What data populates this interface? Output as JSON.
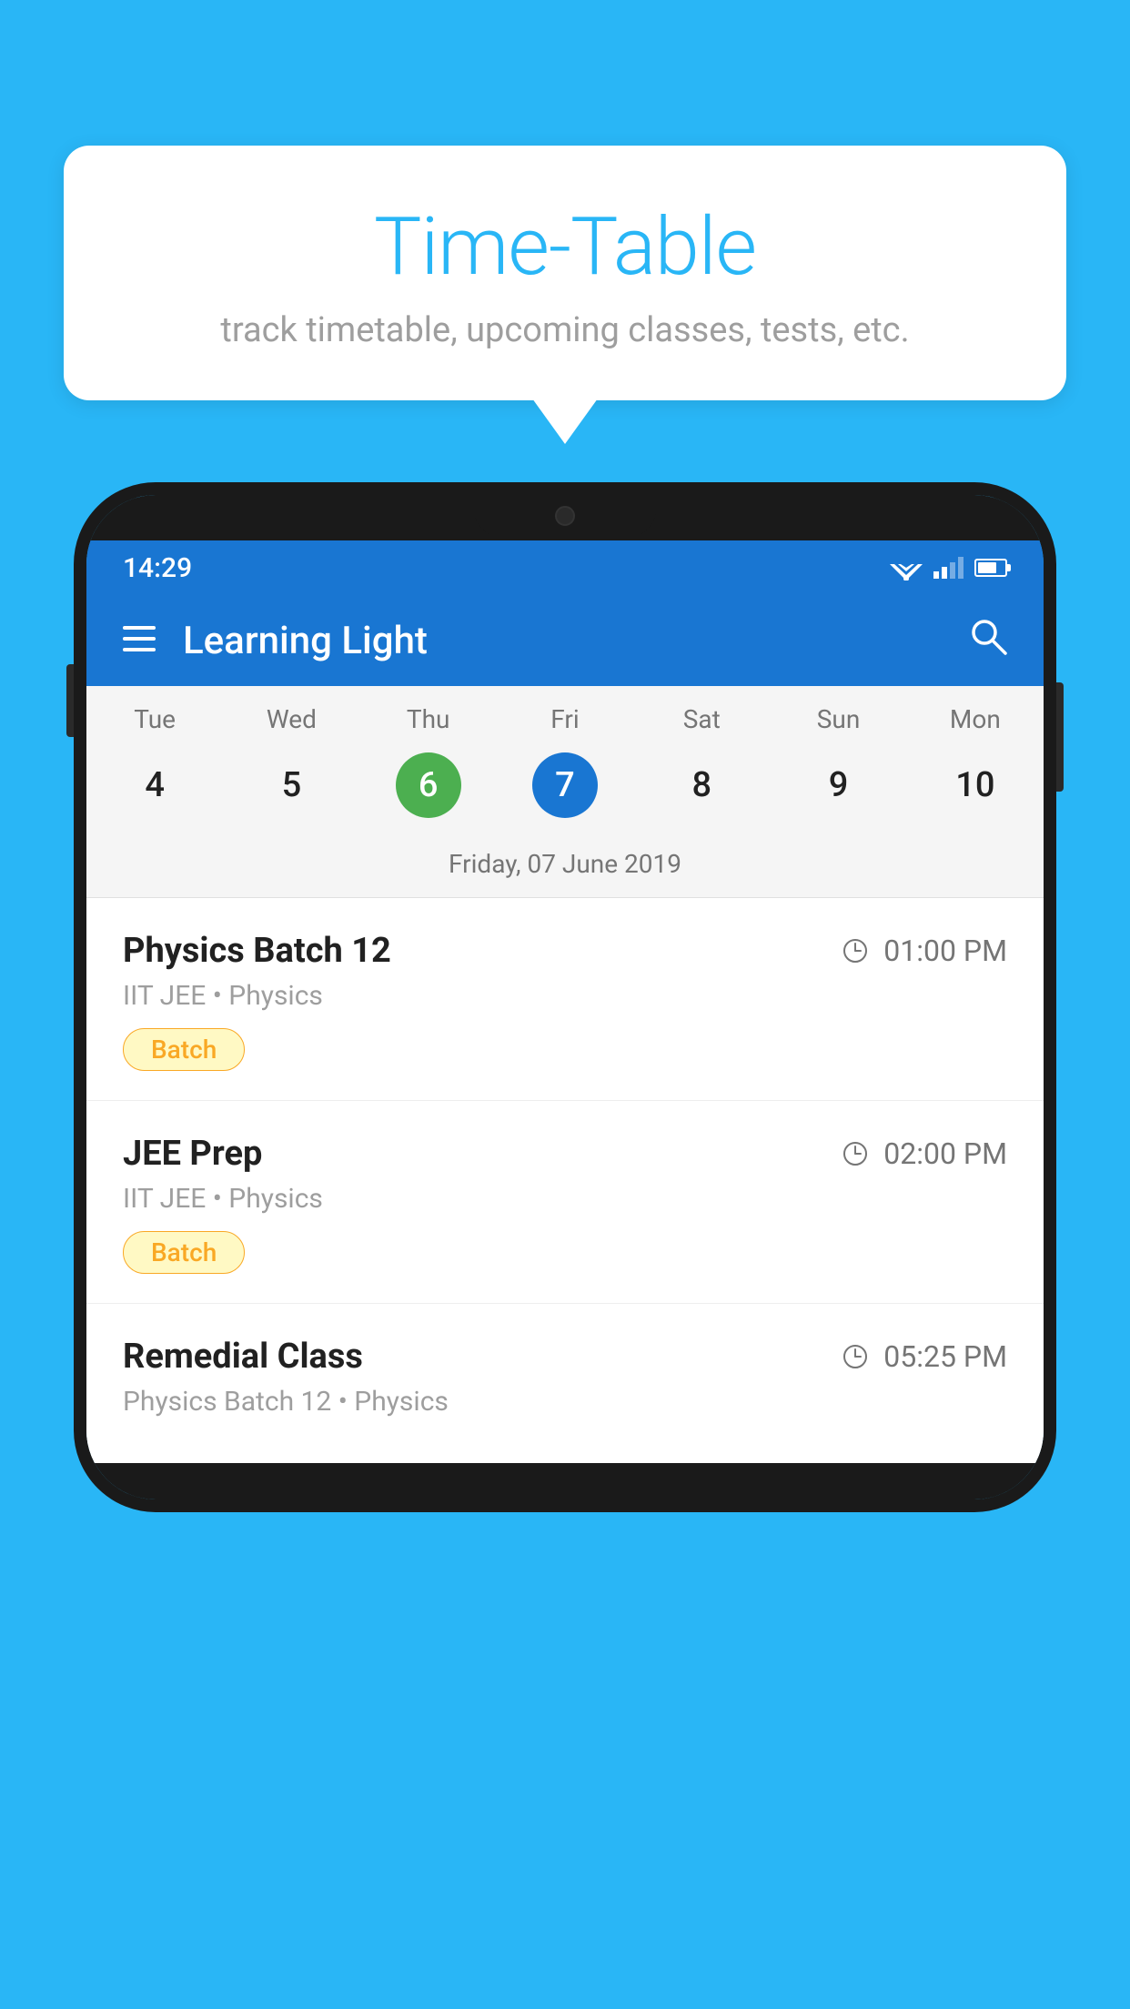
{
  "background_color": "#29B6F6",
  "bubble": {
    "title": "Time-Table",
    "subtitle": "track timetable, upcoming classes, tests, etc."
  },
  "phone": {
    "status_bar": {
      "time": "14:29"
    },
    "app_bar": {
      "title": "Learning Light"
    },
    "calendar": {
      "days": [
        "Tue",
        "Wed",
        "Thu",
        "Fri",
        "Sat",
        "Sun",
        "Mon"
      ],
      "dates": [
        "4",
        "5",
        "6",
        "7",
        "8",
        "9",
        "10"
      ],
      "today_index": 2,
      "selected_index": 3,
      "selected_label": "Friday, 07 June 2019"
    },
    "schedule": [
      {
        "title": "Physics Batch 12",
        "time": "01:00 PM",
        "subtitle": "IIT JEE • Physics",
        "badge": "Batch"
      },
      {
        "title": "JEE Prep",
        "time": "02:00 PM",
        "subtitle": "IIT JEE • Physics",
        "badge": "Batch"
      },
      {
        "title": "Remedial Class",
        "time": "05:25 PM",
        "subtitle": "Physics Batch 12 • Physics",
        "badge": ""
      }
    ]
  }
}
